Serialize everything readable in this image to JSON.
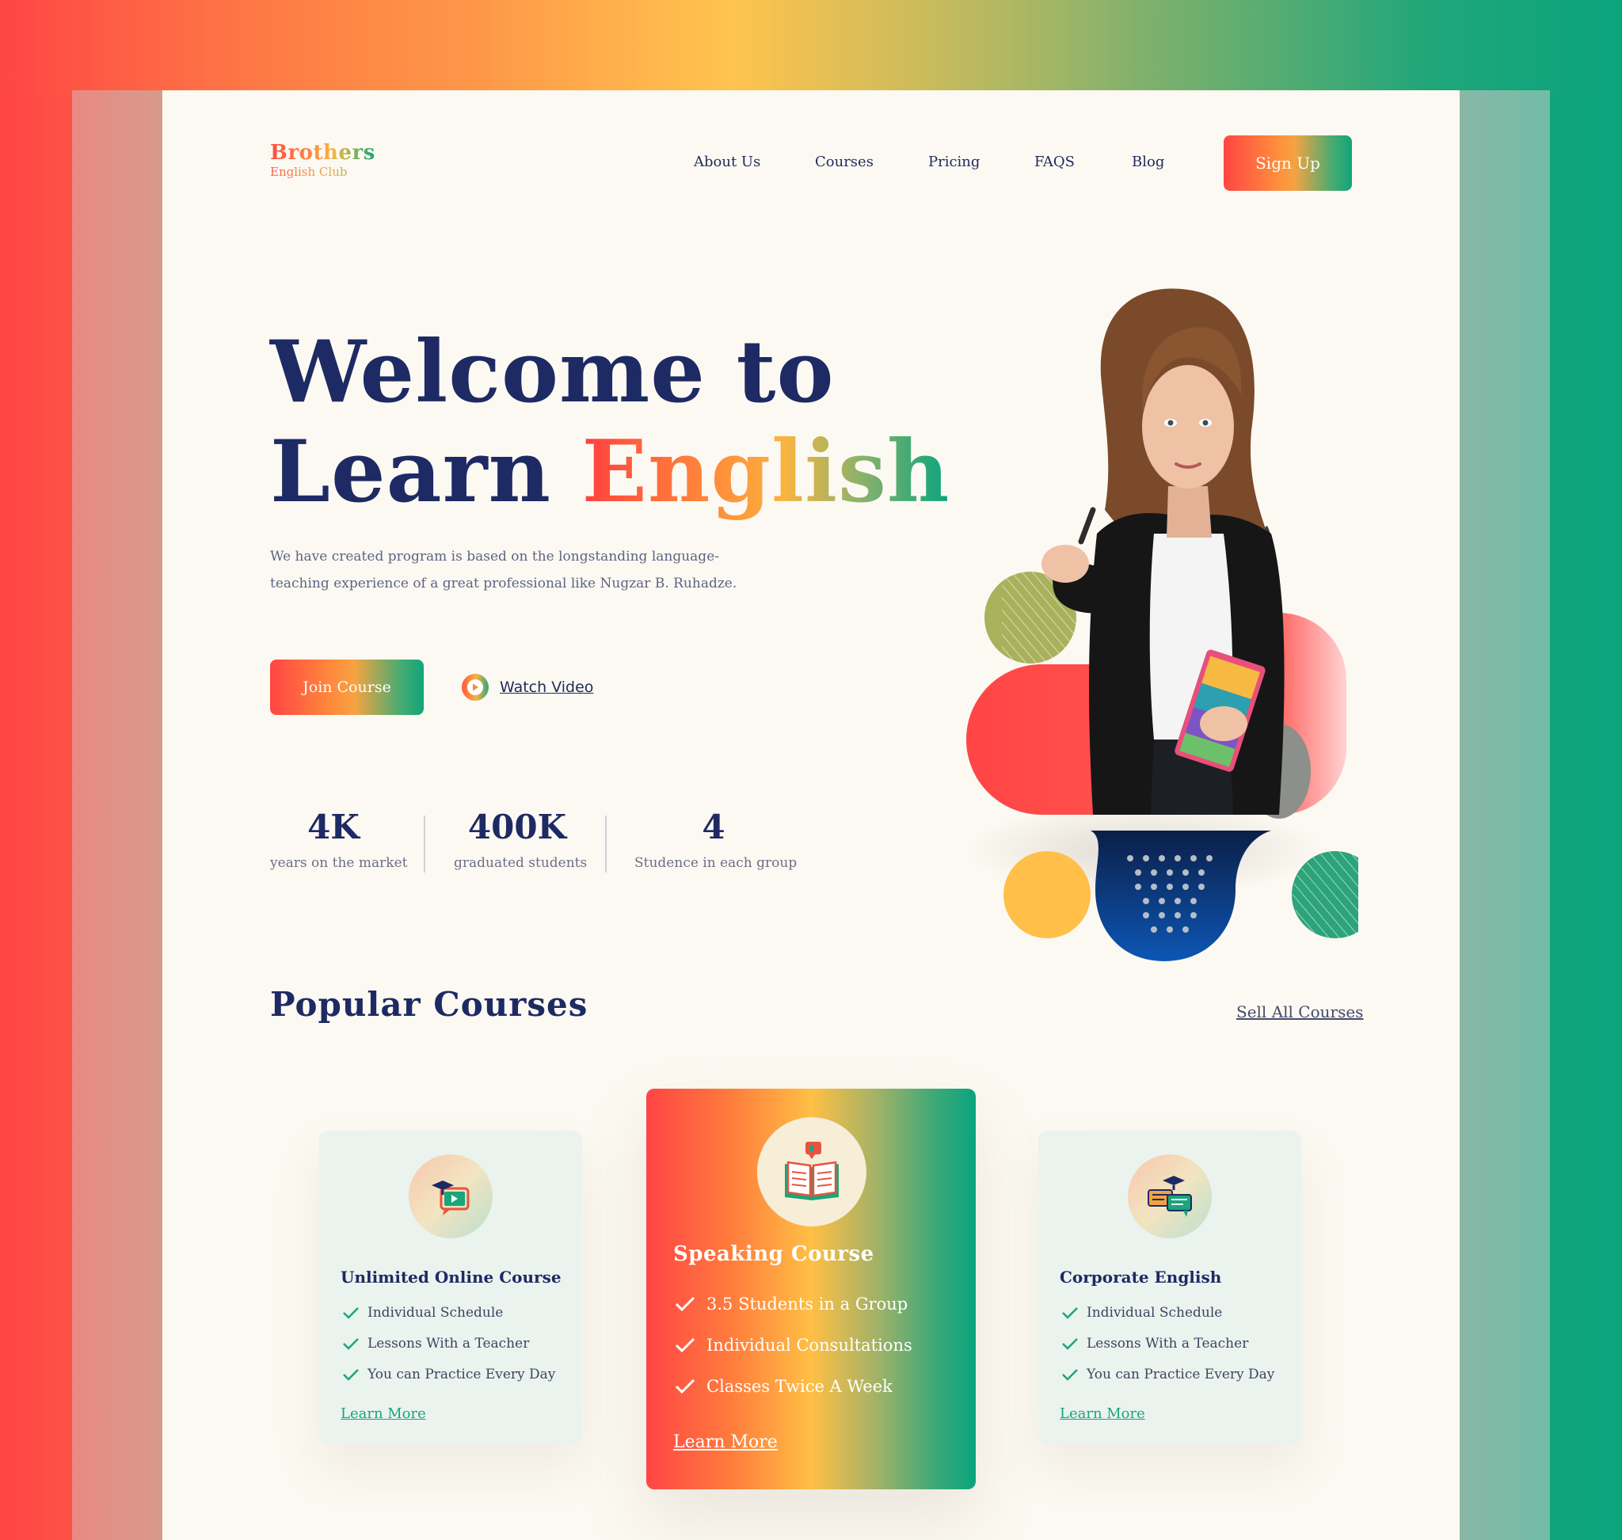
{
  "brand": {
    "name": "Brothers",
    "tagline": "English Club"
  },
  "nav": {
    "items": [
      {
        "label": "About Us"
      },
      {
        "label": "Courses"
      },
      {
        "label": "Pricing"
      },
      {
        "label": "FAQS"
      },
      {
        "label": "Blog"
      }
    ],
    "cta": "Sign Up"
  },
  "hero": {
    "line1": "Welcome to",
    "line2_plain": "Learn ",
    "line2_accent": "English",
    "description": "We have created program is based on the longstanding language-teaching experience of a great professional like Nugzar B. Ruhadze.",
    "primary_button": "Join Course",
    "secondary_button": "Watch Video"
  },
  "stats": [
    {
      "value": "4K",
      "label": "years on the market"
    },
    {
      "value": "400K",
      "label": "graduated students"
    },
    {
      "value": "4",
      "label": "Studence in each group"
    }
  ],
  "courses_section": {
    "title": "Popular Courses",
    "see_all": "Sell All Courses"
  },
  "courses": [
    {
      "title": "Unlimited Online Course",
      "icon": "video-course-icon",
      "features": [
        "Individual Schedule",
        "Lessons With a Teacher",
        "You can Practice Every Day"
      ],
      "link": "Learn More"
    },
    {
      "title": "Speaking Course",
      "icon": "open-book-icon",
      "features": [
        "3.5 Students in a Group",
        "Individual Consultations",
        "Classes Twice A Week"
      ],
      "link": "Learn More"
    },
    {
      "title": "Corporate English",
      "icon": "chat-graduation-icon",
      "features": [
        "Individual Schedule",
        "Lessons With a Teacher",
        "You can Practice Every Day"
      ],
      "link": "Learn More"
    }
  ],
  "colors": {
    "navy": "#1e2a64",
    "red": "#ff4545",
    "orange": "#ff8a3c",
    "yellow": "#ffbf45",
    "green": "#0aa47d",
    "olive": "#a9b15c",
    "cream": "#fcf9f2"
  }
}
